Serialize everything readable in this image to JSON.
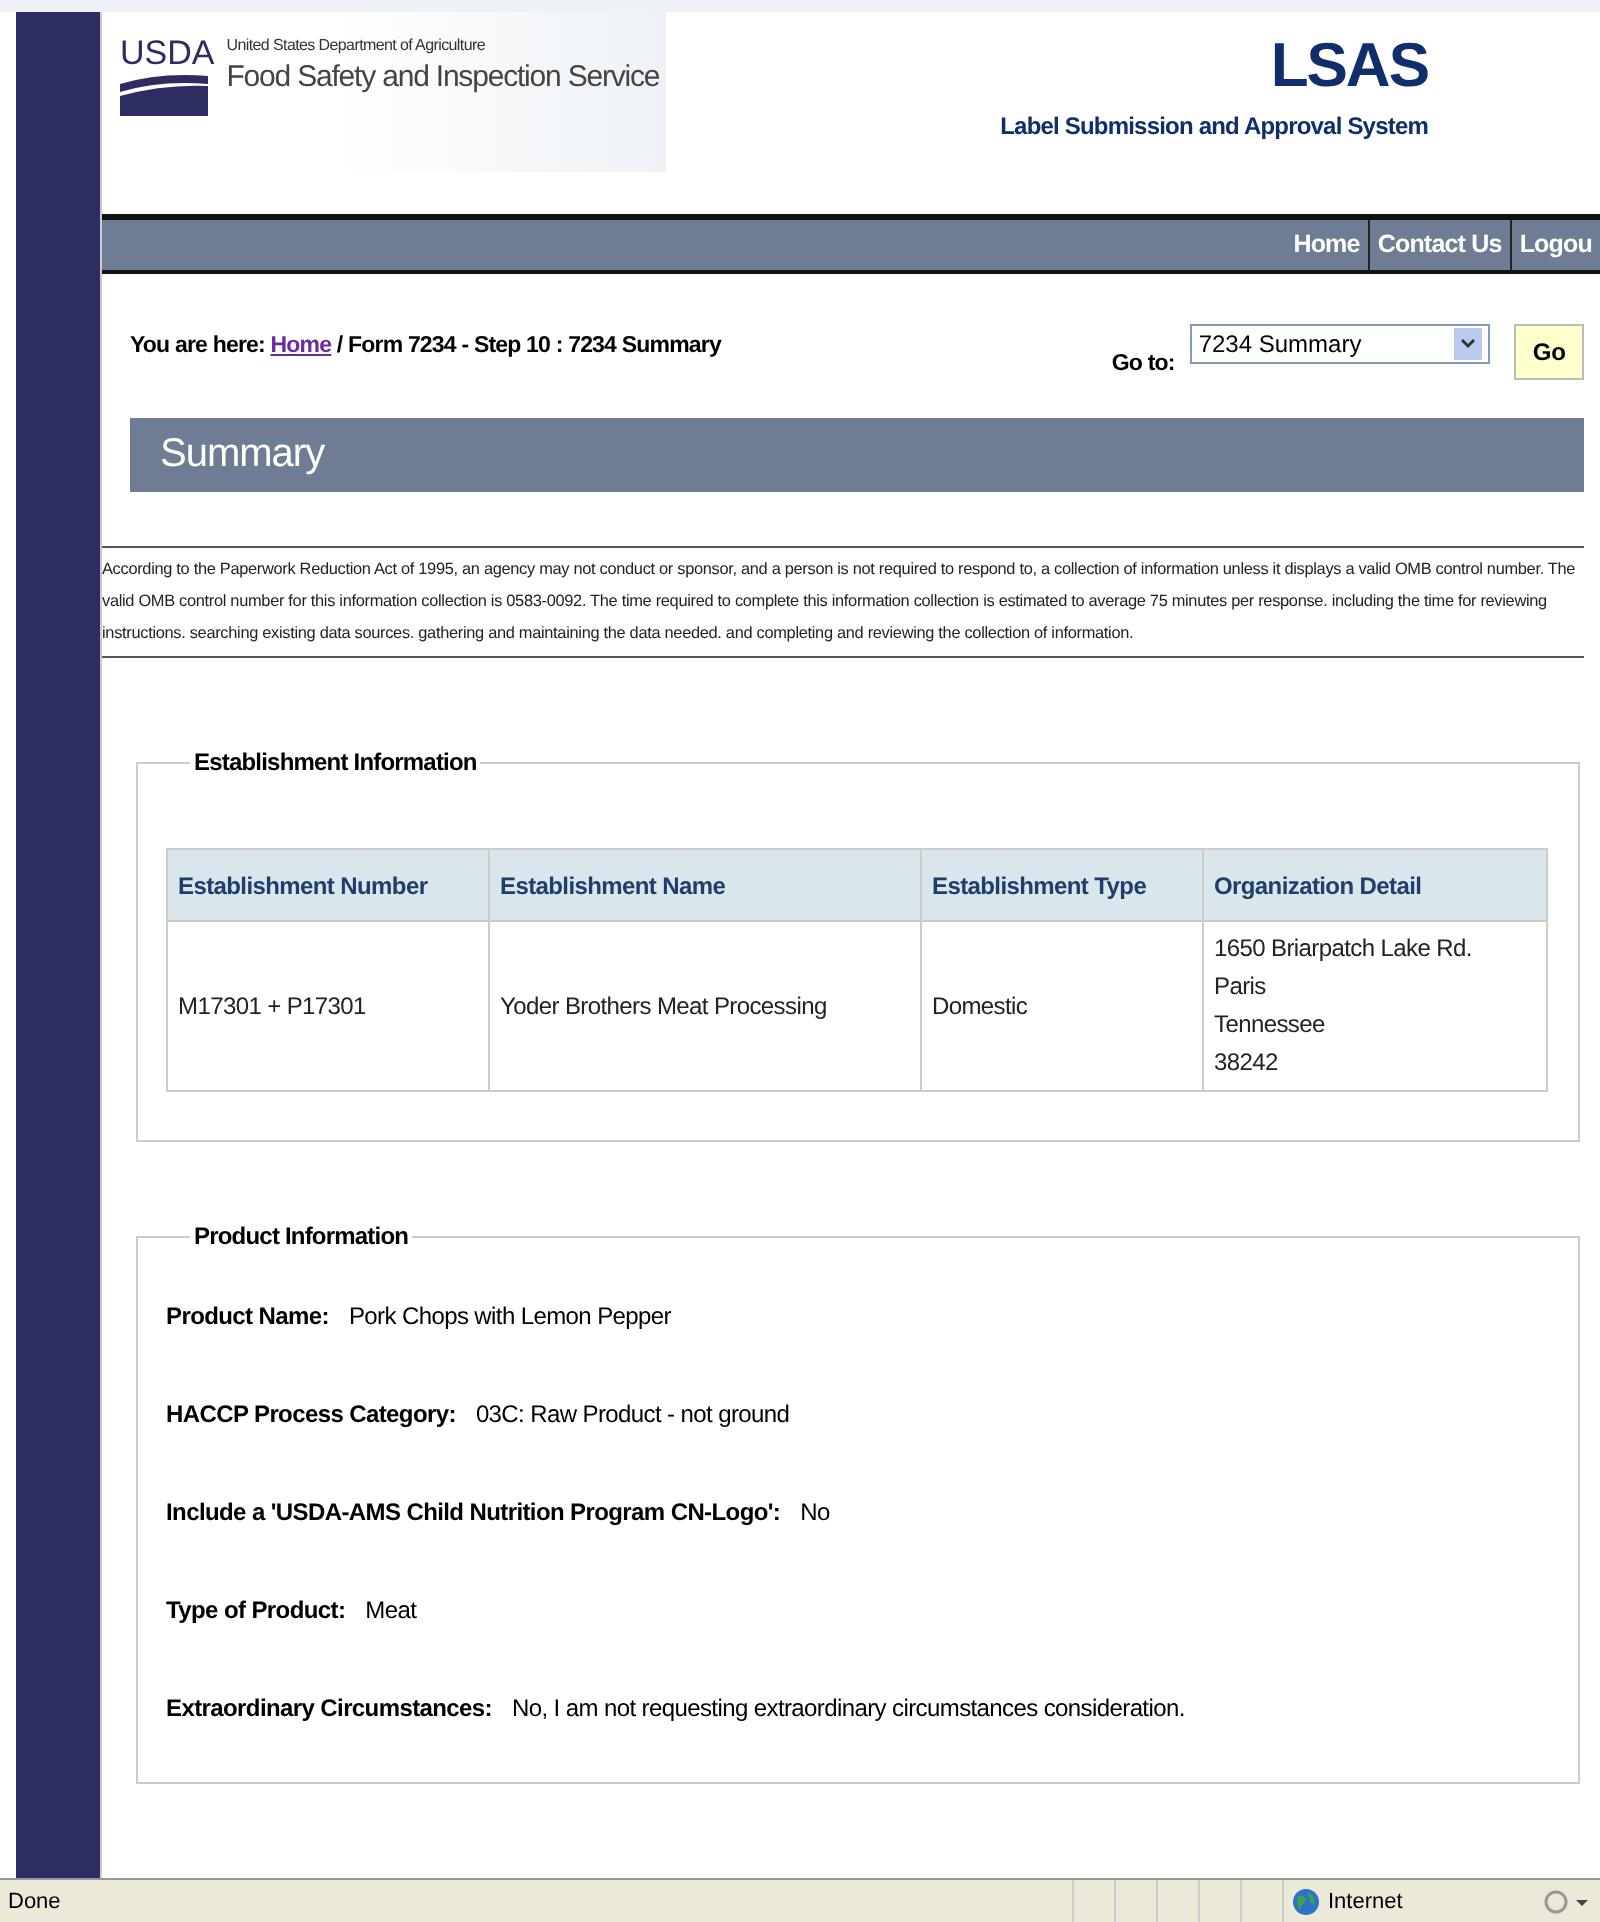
{
  "header": {
    "agency_mark": "USDA",
    "department": "United States Department of Agriculture",
    "service": "Food Safety and Inspection Service",
    "app_name": "LSAS",
    "app_full_name": "Label Submission and Approval System"
  },
  "nav": [
    "Home",
    "Contact Us",
    "Logou"
  ],
  "breadcrumb": {
    "prefix": "You are here:",
    "link": "Home",
    "rest": "/ Form 7234 - Step 10 : 7234 Summary"
  },
  "goto": {
    "label": "Go to:",
    "value": "7234 Summary",
    "button": "Go"
  },
  "page_title": "Summary",
  "notice": "According to the Paperwork Reduction Act of 1995, an agency may not conduct or sponsor, and a person is not required to respond to, a collection of information unless it displays a valid OMB control number. The valid OMB control number for this information collection is 0583-0092. The time required to complete this information collection is estimated to average 75 minutes per response. including the time for reviewing instructions. searching existing data sources. gathering and maintaining the data needed. and completing and reviewing the collection of information.",
  "establishment": {
    "legend": "Establishment Information",
    "columns": [
      "Establishment Number",
      "Establishment Name",
      "Establishment Type",
      "Organization Detail"
    ],
    "rows": [
      {
        "number": "M17301 + P17301",
        "name": "Yoder Brothers Meat Processing",
        "type": "Domestic",
        "detail": [
          "1650 Briarpatch Lake Rd.",
          "Paris",
          "Tennessee",
          "38242"
        ]
      }
    ]
  },
  "product": {
    "legend": "Product Information",
    "fields": [
      {
        "label": "Product Name:",
        "value": "Pork Chops with Lemon Pepper"
      },
      {
        "label": "HACCP Process Category:",
        "value": "03C: Raw Product - not ground"
      },
      {
        "label": "Include a 'USDA-AMS Child Nutrition Program CN-Logo':",
        "value": "No"
      },
      {
        "label": "Type of Product:",
        "value": "Meat"
      },
      {
        "label": "Extraordinary Circumstances:",
        "value": "No, I am not requesting extraordinary circumstances consideration."
      }
    ]
  },
  "status_bar": {
    "status": "Done",
    "zone": "Internet"
  }
}
